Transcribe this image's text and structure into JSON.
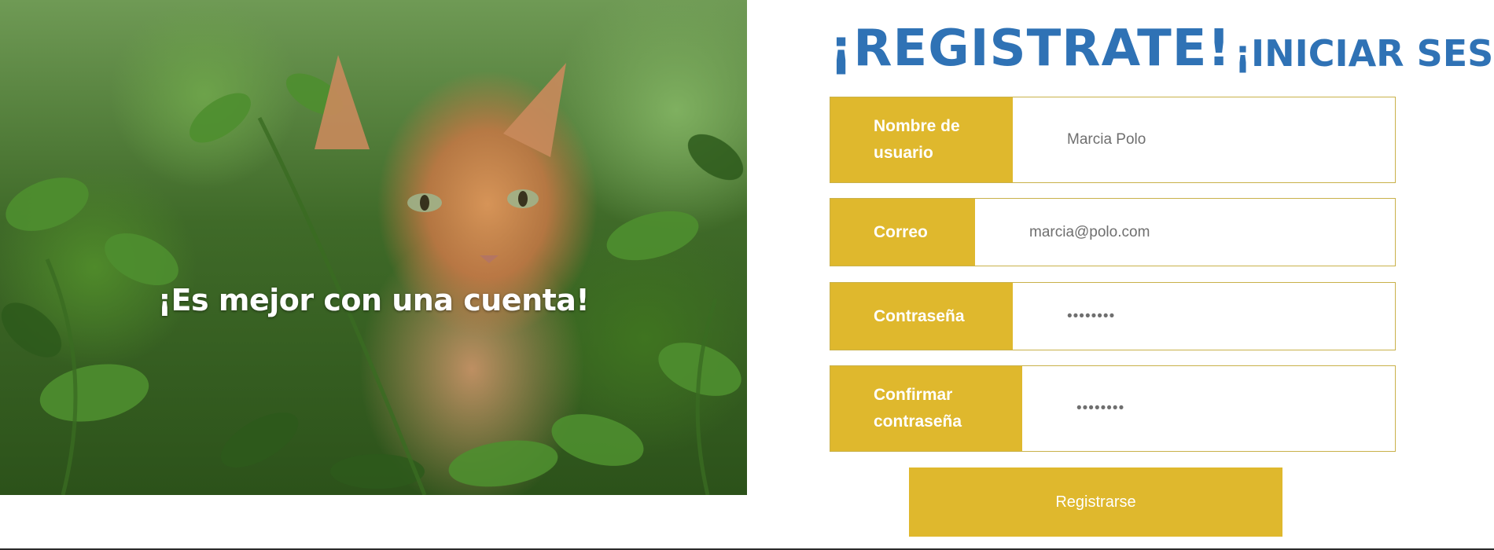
{
  "hero": {
    "tagline": "¡Es mejor con una cuenta!"
  },
  "header": {
    "register_title": "¡REGISTRATE!",
    "login_link": "¡INICIAR SESION"
  },
  "form": {
    "fields": [
      {
        "label": "Nombre de usuario",
        "value": "Marcia Polo",
        "type": "text"
      },
      {
        "label": "Correo",
        "value": "marcia@polo.com",
        "type": "email"
      },
      {
        "label": "Contraseña",
        "value": "••••••••",
        "type": "password"
      },
      {
        "label": "Confirmar contraseña",
        "value": "••••••••",
        "type": "password"
      }
    ],
    "submit_label": "Registrarse"
  },
  "colors": {
    "accent_yellow": "#dfb82d",
    "title_blue": "#2f72b5",
    "input_text": "#6f6f6f"
  }
}
